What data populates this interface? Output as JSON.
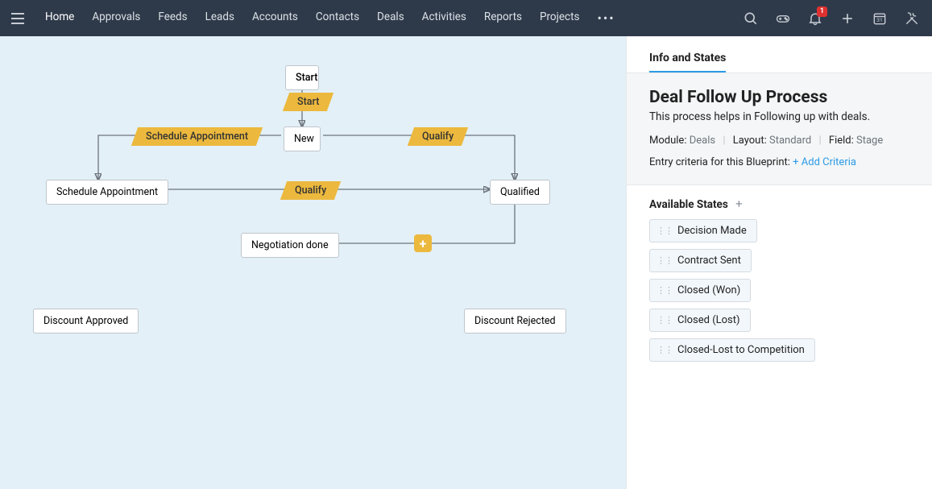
{
  "nav": {
    "items": [
      "Home",
      "Approvals",
      "Feeds",
      "Leads",
      "Accounts",
      "Contacts",
      "Deals",
      "Activities",
      "Reports",
      "Projects"
    ],
    "more": "•••",
    "notification_count": "1"
  },
  "canvas": {
    "nodes": {
      "start": "Start",
      "new": "New",
      "schedule_appt": "Schedule Appointment",
      "qualified": "Qualified",
      "negotiation_done": "Negotiation done",
      "discount_approved": "Discount Approved",
      "discount_rejected": "Discount Rejected"
    },
    "transitions": {
      "start": "Start",
      "schedule_appt": "Schedule Appointment",
      "qualify1": "Qualify",
      "qualify2": "Qualify"
    },
    "add_glyph": "+"
  },
  "panel": {
    "tab": "Info and States",
    "title": "Deal Follow Up Process",
    "desc": "This process helps in Following up with deals.",
    "module_lbl": "Module:",
    "module_val": "Deals",
    "layout_lbl": "Layout:",
    "layout_val": "Standard",
    "field_lbl": "Field:",
    "field_val": "Stage",
    "criteria_lbl": "Entry criteria for this Blueprint:",
    "criteria_link": "+ Add Criteria",
    "states_header": "Available States",
    "states": [
      "Decision Made",
      "Contract Sent",
      "Closed (Won)",
      "Closed (Lost)",
      "Closed-Lost to Competition"
    ]
  }
}
